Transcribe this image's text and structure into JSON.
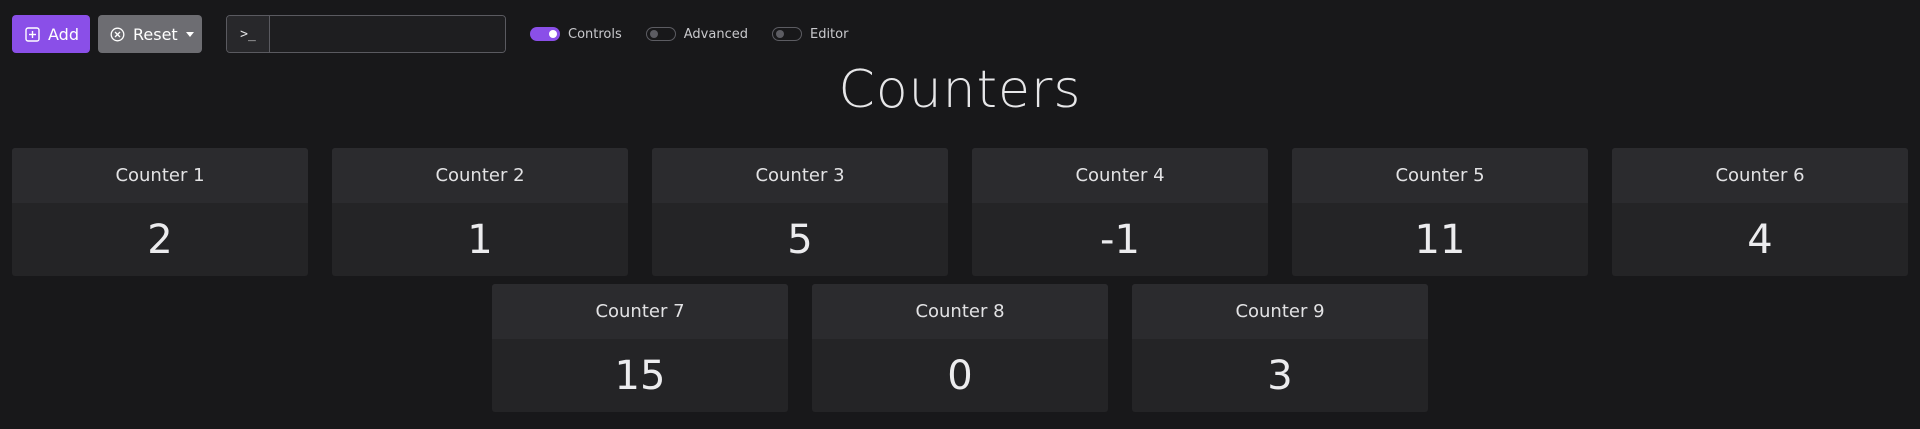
{
  "toolbar": {
    "add_label": "Add",
    "reset_label": "Reset",
    "command_prefix": ">_",
    "command_value": "",
    "toggles": [
      {
        "label": "Controls",
        "on": true
      },
      {
        "label": "Advanced",
        "on": false
      },
      {
        "label": "Editor",
        "on": false
      }
    ]
  },
  "page_title": "Counters",
  "counters": [
    {
      "label": "Counter 1",
      "value": "2"
    },
    {
      "label": "Counter 2",
      "value": "1"
    },
    {
      "label": "Counter 3",
      "value": "5"
    },
    {
      "label": "Counter 4",
      "value": "-1"
    },
    {
      "label": "Counter 5",
      "value": "11"
    },
    {
      "label": "Counter 6",
      "value": "4"
    },
    {
      "label": "Counter 7",
      "value": "15"
    },
    {
      "label": "Counter 8",
      "value": "0"
    },
    {
      "label": "Counter 9",
      "value": "3"
    }
  ],
  "colors": {
    "accent": "#8a4fe8",
    "secondary_button": "#6d6d72",
    "background": "#18181a",
    "card": "#242426",
    "card_header": "#2b2b2e"
  },
  "icons": {
    "add": "plus-square-icon",
    "reset": "x-circle-icon",
    "dropdown": "chevron-down-icon"
  }
}
